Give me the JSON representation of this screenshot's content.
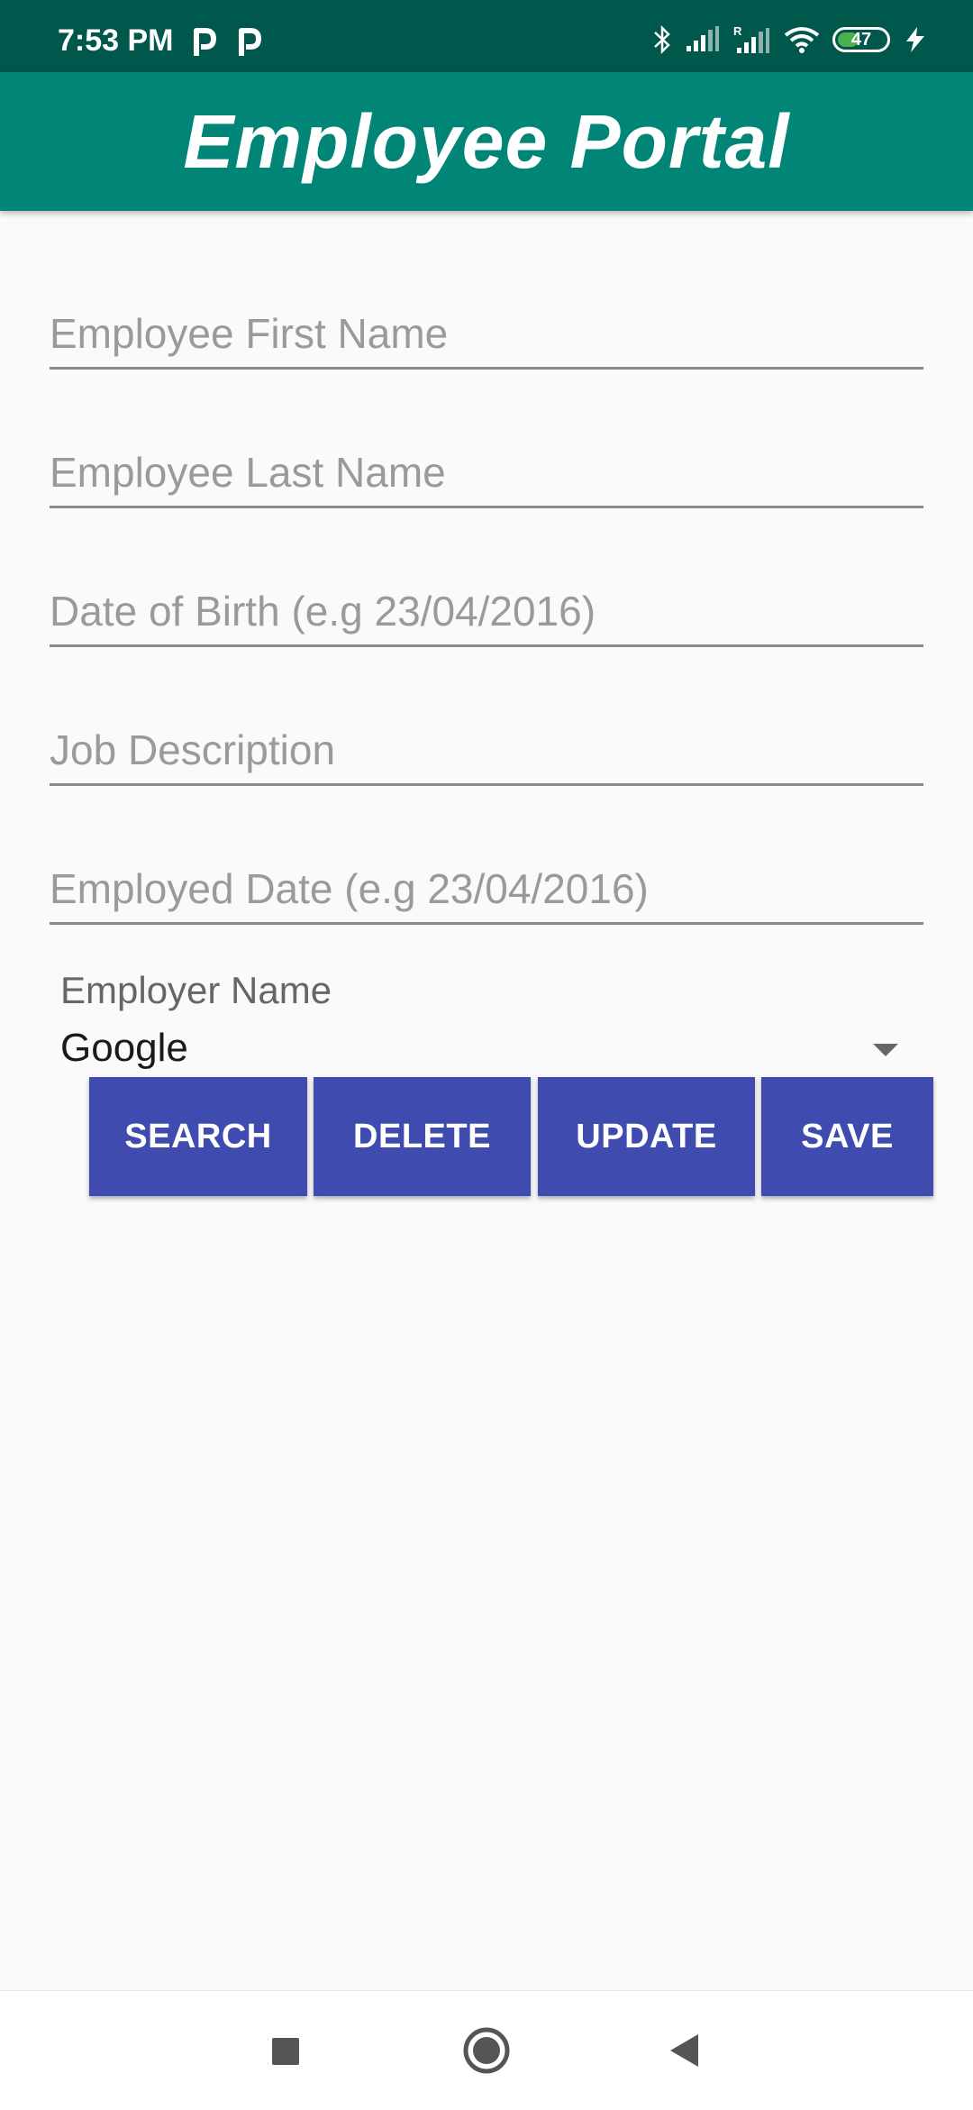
{
  "status_bar": {
    "time": "7:53 PM",
    "battery_level": "47",
    "icons": [
      "p-app-icon",
      "p-app-icon",
      "bluetooth-icon",
      "signal-icon",
      "signal-roaming-icon",
      "wifi-icon",
      "battery-icon",
      "charging-icon"
    ]
  },
  "app_bar": {
    "title": "Employee Portal"
  },
  "form": {
    "first_name_placeholder": "Employee First Name",
    "last_name_placeholder": "Employee Last Name",
    "dob_placeholder": "Date of Birth (e.g 23/04/2016)",
    "job_description_placeholder": "Job Description",
    "employed_date_placeholder": "Employed Date (e.g 23/04/2016)",
    "employer_label": "Employer Name",
    "employer_value": "Google"
  },
  "buttons": {
    "search": "SEARCH",
    "delete": "DELETE",
    "update": "UPDATE",
    "save": "SAVE"
  },
  "nav_bar": {
    "icons": [
      "recents-icon",
      "home-icon",
      "back-icon"
    ]
  },
  "colors": {
    "status_bar": "#00574b",
    "app_bar": "#008577",
    "button": "#3f4bae",
    "background": "#fafafa"
  }
}
